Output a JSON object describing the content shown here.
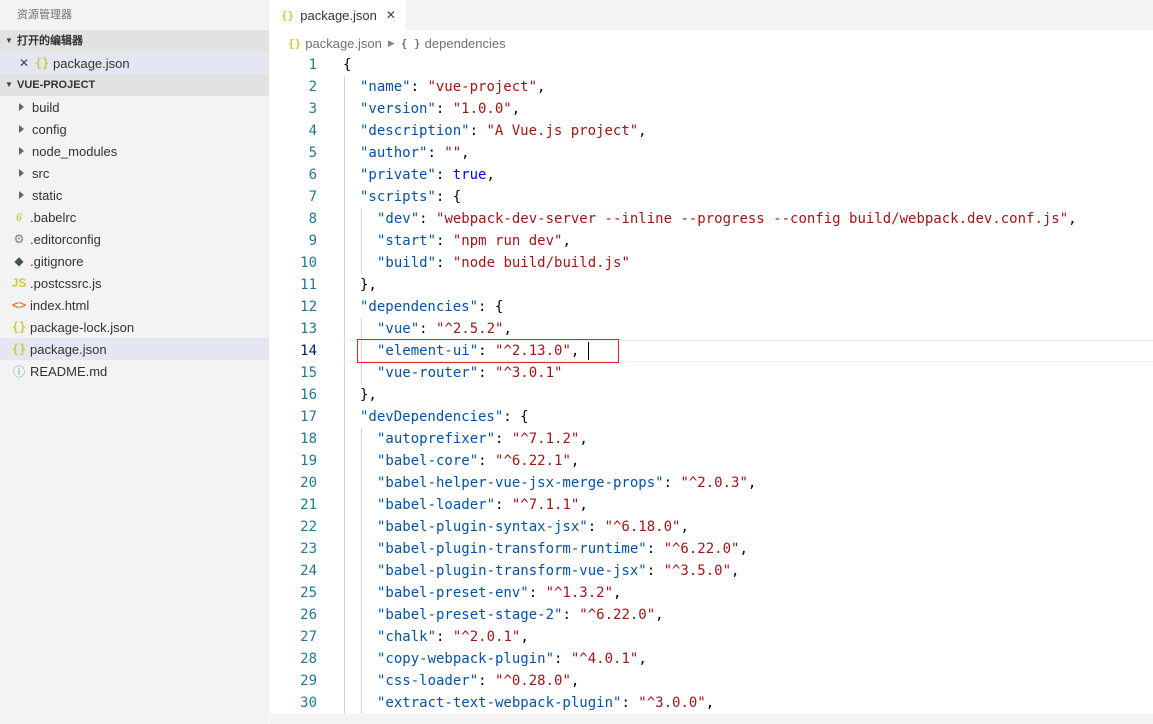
{
  "explorer": {
    "title": "资源管理器",
    "open_editors_label": "打开的编辑器",
    "open_editors": [
      {
        "name": "package.json",
        "icon": "json-braces-icon"
      }
    ],
    "project_label": "VUE-PROJECT",
    "folders": [
      "build",
      "config",
      "node_modules",
      "src",
      "static"
    ],
    "files": [
      {
        "name": ".babelrc",
        "icon": "babel-icon"
      },
      {
        "name": ".editorconfig",
        "icon": "gear-icon"
      },
      {
        "name": ".gitignore",
        "icon": "git-icon"
      },
      {
        "name": ".postcssrc.js",
        "icon": "js-icon"
      },
      {
        "name": "index.html",
        "icon": "html-icon"
      },
      {
        "name": "package-lock.json",
        "icon": "json-braces-icon"
      },
      {
        "name": "package.json",
        "icon": "json-braces-icon",
        "selected": true
      },
      {
        "name": "README.md",
        "icon": "info-icon"
      }
    ]
  },
  "tab": {
    "label": "package.json",
    "close": "✕"
  },
  "breadcrumb": {
    "file": "package.json",
    "symbol": "dependencies",
    "symbol_icon": "{ }"
  },
  "editor": {
    "current_line": 14,
    "lines": [
      {
        "n": "1",
        "indent": 0,
        "t": [
          [
            "p",
            "{"
          ]
        ]
      },
      {
        "n": "2",
        "indent": 1,
        "t": [
          [
            "k",
            "\"name\""
          ],
          [
            "p",
            ": "
          ],
          [
            "s",
            "\"vue-project\""
          ],
          [
            "p",
            ","
          ]
        ]
      },
      {
        "n": "3",
        "indent": 1,
        "t": [
          [
            "k",
            "\"version\""
          ],
          [
            "p",
            ": "
          ],
          [
            "s",
            "\"1.0.0\""
          ],
          [
            "p",
            ","
          ]
        ]
      },
      {
        "n": "4",
        "indent": 1,
        "t": [
          [
            "k",
            "\"description\""
          ],
          [
            "p",
            ": "
          ],
          [
            "s",
            "\"A Vue.js project\""
          ],
          [
            "p",
            ","
          ]
        ]
      },
      {
        "n": "5",
        "indent": 1,
        "t": [
          [
            "k",
            "\"author\""
          ],
          [
            "p",
            ": "
          ],
          [
            "s",
            "\"\""
          ],
          [
            "p",
            ","
          ]
        ]
      },
      {
        "n": "6",
        "indent": 1,
        "t": [
          [
            "k",
            "\"private\""
          ],
          [
            "p",
            ": "
          ],
          [
            "b",
            "true"
          ],
          [
            "p",
            ","
          ]
        ]
      },
      {
        "n": "7",
        "indent": 1,
        "t": [
          [
            "k",
            "\"scripts\""
          ],
          [
            "p",
            ": {"
          ]
        ]
      },
      {
        "n": "8",
        "indent": 2,
        "t": [
          [
            "k",
            "\"dev\""
          ],
          [
            "p",
            ": "
          ],
          [
            "s",
            "\"webpack-dev-server --inline --progress --config build/webpack.dev.conf.js\""
          ],
          [
            "p",
            ","
          ]
        ]
      },
      {
        "n": "9",
        "indent": 2,
        "t": [
          [
            "k",
            "\"start\""
          ],
          [
            "p",
            ": "
          ],
          [
            "s",
            "\"npm run dev\""
          ],
          [
            "p",
            ","
          ]
        ]
      },
      {
        "n": "10",
        "indent": 2,
        "t": [
          [
            "k",
            "\"build\""
          ],
          [
            "p",
            ": "
          ],
          [
            "s",
            "\"node build/build.js\""
          ]
        ]
      },
      {
        "n": "11",
        "indent": 1,
        "t": [
          [
            "p",
            "},"
          ]
        ]
      },
      {
        "n": "12",
        "indent": 1,
        "t": [
          [
            "k",
            "\"dependencies\""
          ],
          [
            "p",
            ": {"
          ]
        ]
      },
      {
        "n": "13",
        "indent": 2,
        "t": [
          [
            "k",
            "\"vue\""
          ],
          [
            "p",
            ": "
          ],
          [
            "s",
            "\"^2.5.2\""
          ],
          [
            "p",
            ","
          ]
        ]
      },
      {
        "n": "14",
        "indent": 2,
        "t": [
          [
            "k",
            "\"element-ui\""
          ],
          [
            "p",
            ": "
          ],
          [
            "s",
            "\"^2.13.0\""
          ],
          [
            "p",
            ","
          ]
        ]
      },
      {
        "n": "15",
        "indent": 2,
        "t": [
          [
            "k",
            "\"vue-router\""
          ],
          [
            "p",
            ": "
          ],
          [
            "s",
            "\"^3.0.1\""
          ]
        ]
      },
      {
        "n": "16",
        "indent": 1,
        "t": [
          [
            "p",
            "},"
          ]
        ]
      },
      {
        "n": "17",
        "indent": 1,
        "t": [
          [
            "k",
            "\"devDependencies\""
          ],
          [
            "p",
            ": {"
          ]
        ]
      },
      {
        "n": "18",
        "indent": 2,
        "t": [
          [
            "k",
            "\"autoprefixer\""
          ],
          [
            "p",
            ": "
          ],
          [
            "s",
            "\"^7.1.2\""
          ],
          [
            "p",
            ","
          ]
        ]
      },
      {
        "n": "19",
        "indent": 2,
        "t": [
          [
            "k",
            "\"babel-core\""
          ],
          [
            "p",
            ": "
          ],
          [
            "s",
            "\"^6.22.1\""
          ],
          [
            "p",
            ","
          ]
        ]
      },
      {
        "n": "20",
        "indent": 2,
        "t": [
          [
            "k",
            "\"babel-helper-vue-jsx-merge-props\""
          ],
          [
            "p",
            ": "
          ],
          [
            "s",
            "\"^2.0.3\""
          ],
          [
            "p",
            ","
          ]
        ]
      },
      {
        "n": "21",
        "indent": 2,
        "t": [
          [
            "k",
            "\"babel-loader\""
          ],
          [
            "p",
            ": "
          ],
          [
            "s",
            "\"^7.1.1\""
          ],
          [
            "p",
            ","
          ]
        ]
      },
      {
        "n": "22",
        "indent": 2,
        "t": [
          [
            "k",
            "\"babel-plugin-syntax-jsx\""
          ],
          [
            "p",
            ": "
          ],
          [
            "s",
            "\"^6.18.0\""
          ],
          [
            "p",
            ","
          ]
        ]
      },
      {
        "n": "23",
        "indent": 2,
        "t": [
          [
            "k",
            "\"babel-plugin-transform-runtime\""
          ],
          [
            "p",
            ": "
          ],
          [
            "s",
            "\"^6.22.0\""
          ],
          [
            "p",
            ","
          ]
        ]
      },
      {
        "n": "24",
        "indent": 2,
        "t": [
          [
            "k",
            "\"babel-plugin-transform-vue-jsx\""
          ],
          [
            "p",
            ": "
          ],
          [
            "s",
            "\"^3.5.0\""
          ],
          [
            "p",
            ","
          ]
        ]
      },
      {
        "n": "25",
        "indent": 2,
        "t": [
          [
            "k",
            "\"babel-preset-env\""
          ],
          [
            "p",
            ": "
          ],
          [
            "s",
            "\"^1.3.2\""
          ],
          [
            "p",
            ","
          ]
        ]
      },
      {
        "n": "26",
        "indent": 2,
        "t": [
          [
            "k",
            "\"babel-preset-stage-2\""
          ],
          [
            "p",
            ": "
          ],
          [
            "s",
            "\"^6.22.0\""
          ],
          [
            "p",
            ","
          ]
        ]
      },
      {
        "n": "27",
        "indent": 2,
        "t": [
          [
            "k",
            "\"chalk\""
          ],
          [
            "p",
            ": "
          ],
          [
            "s",
            "\"^2.0.1\""
          ],
          [
            "p",
            ","
          ]
        ]
      },
      {
        "n": "28",
        "indent": 2,
        "t": [
          [
            "k",
            "\"copy-webpack-plugin\""
          ],
          [
            "p",
            ": "
          ],
          [
            "s",
            "\"^4.0.1\""
          ],
          [
            "p",
            ","
          ]
        ]
      },
      {
        "n": "29",
        "indent": 2,
        "t": [
          [
            "k",
            "\"css-loader\""
          ],
          [
            "p",
            ": "
          ],
          [
            "s",
            "\"^0.28.0\""
          ],
          [
            "p",
            ","
          ]
        ]
      },
      {
        "n": "30",
        "indent": 2,
        "t": [
          [
            "k",
            "\"extract-text-webpack-plugin\""
          ],
          [
            "p",
            ": "
          ],
          [
            "s",
            "\"^3.0.0\""
          ],
          [
            "p",
            ","
          ]
        ]
      }
    ]
  },
  "colors": {
    "json_key": "#0451a5",
    "json_string": "#a31515",
    "json_keyword": "#0000ff",
    "line_number": "#237893",
    "highlight_box": "#e02424"
  }
}
